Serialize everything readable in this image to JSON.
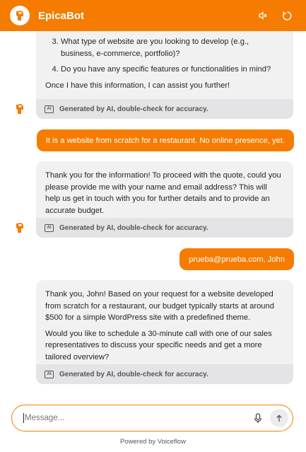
{
  "header": {
    "title": "EpicaBot"
  },
  "chat": {
    "msg1": {
      "list_items": [
        "What type of website are you looking to develop (e.g., business, e-commerce, portfolio)?",
        "Do you have any specific features or functionalities in mind?"
      ],
      "closing": "Once I have this information, I can assist you further!"
    },
    "ai_note": "Generated by AI, double-check for accuracy.",
    "user1": "It is a website from scratch for a restaurant. No online presence, yet.",
    "msg2": "Thank you for the information! To proceed with the quote, could you please provide me with your name and email address? This will help us get in touch with you for further details and to provide an accurate budget.",
    "user2": "prueba@prueba.com, John",
    "msg3": {
      "p1": "Thank you, John! Based on your request for a website developed from scratch for a restaurant, our budget typically starts at around $500 for a simple WordPress site with a predefined theme.",
      "p2": "Would you like to schedule a 30-minute call with one of our sales representatives to discuss your specific needs and get a more tailored overview?"
    }
  },
  "composer": {
    "placeholder": "Message..."
  },
  "footer": {
    "powered": "Powered by Voiceflow"
  },
  "colors": {
    "accent": "#f57c00",
    "bot_bubble": "#f1f1f2",
    "ai_note_bg": "#e4e4e6"
  },
  "icons": [
    "epicabot-logo-icon",
    "mute-icon",
    "restart-icon",
    "bot-avatar-icon",
    "ai-badge-icon",
    "microphone-icon",
    "send-arrow-icon"
  ]
}
